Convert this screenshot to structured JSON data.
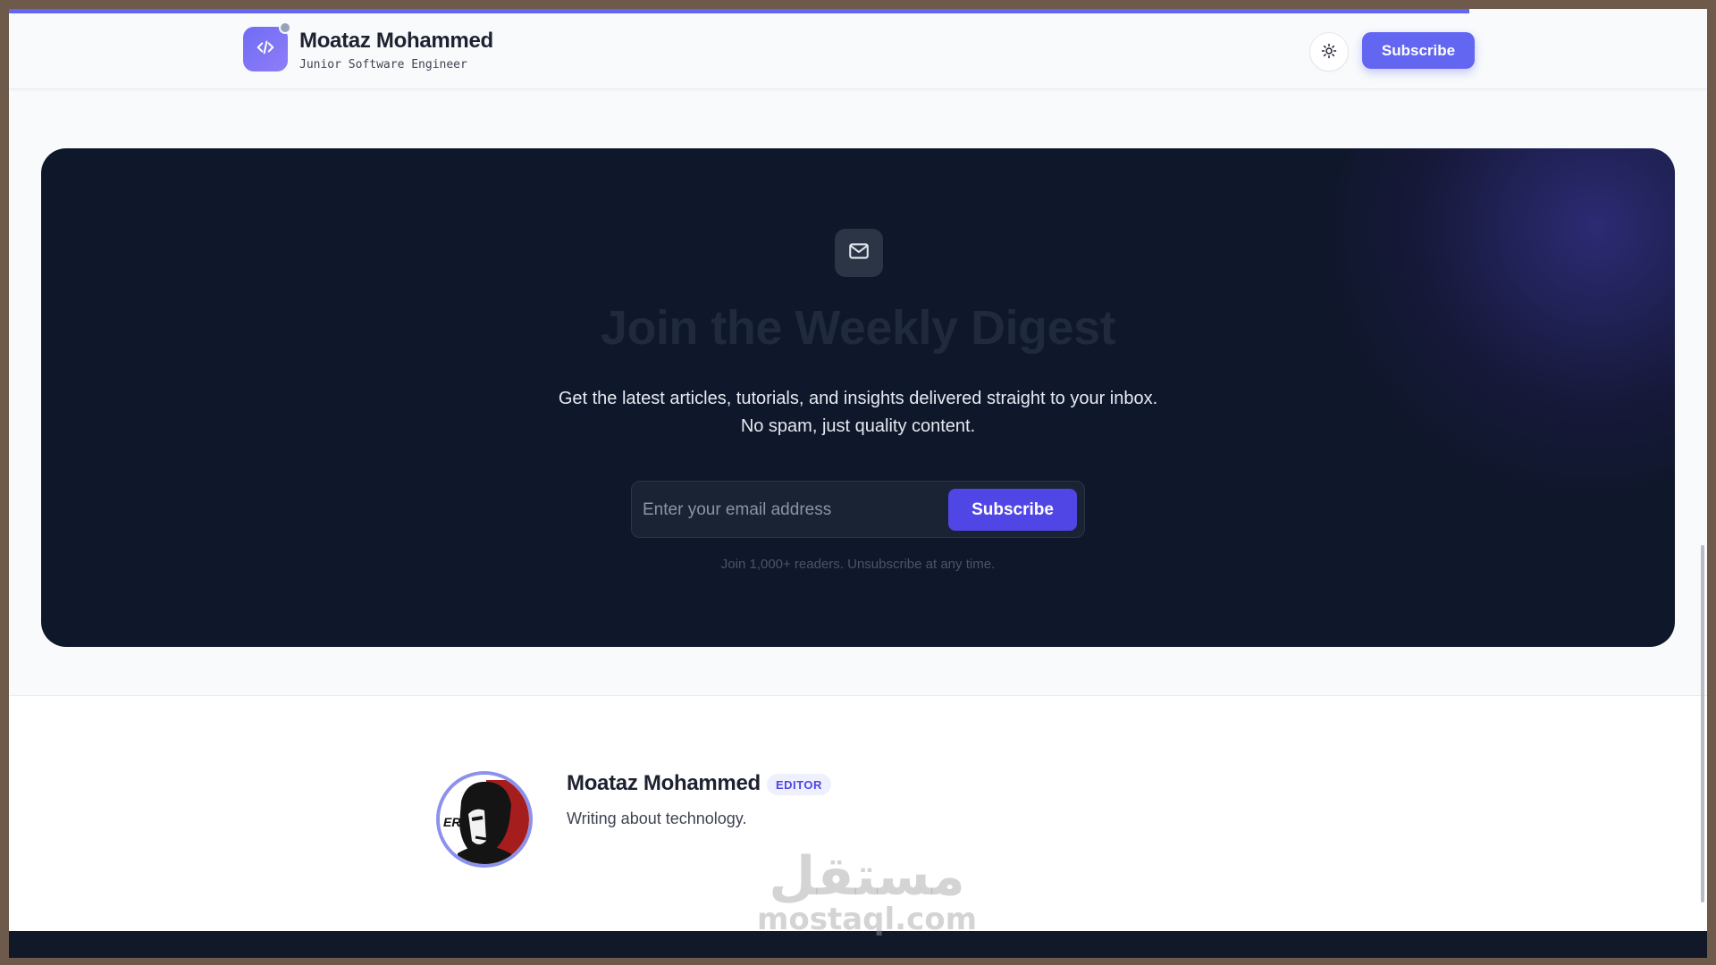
{
  "header": {
    "brand_name": "Moataz Mohammed",
    "brand_role": "Junior Software Engineer",
    "subscribe_label": "Subscribe",
    "logo_icon": "code-icon",
    "theme_icon": "sun-icon",
    "scroll_progress": 0.86
  },
  "hero": {
    "icon": "mail-icon",
    "title": "Join the Weekly Digest",
    "description_line1": "Get the latest articles, tutorials, and insights delivered straight to your inbox.",
    "description_line2": "No spam, just quality content.",
    "email_placeholder": "Enter your email address",
    "email_value": "",
    "subscribe_label": "Subscribe",
    "note": "Join 1,000+ readers. Unsubscribe at any time."
  },
  "author": {
    "name": "Moataz Mohammed",
    "badge": "EDITOR",
    "bio": "Writing about technology.",
    "avatar_text": "ER"
  },
  "watermark": {
    "arabic": "مستقل",
    "latin": "mostaql.com"
  },
  "colors": {
    "accent": "#6366f1",
    "hero_bg": "#0f172a",
    "page_bg": "#f8fafc",
    "footer": "#111827"
  }
}
